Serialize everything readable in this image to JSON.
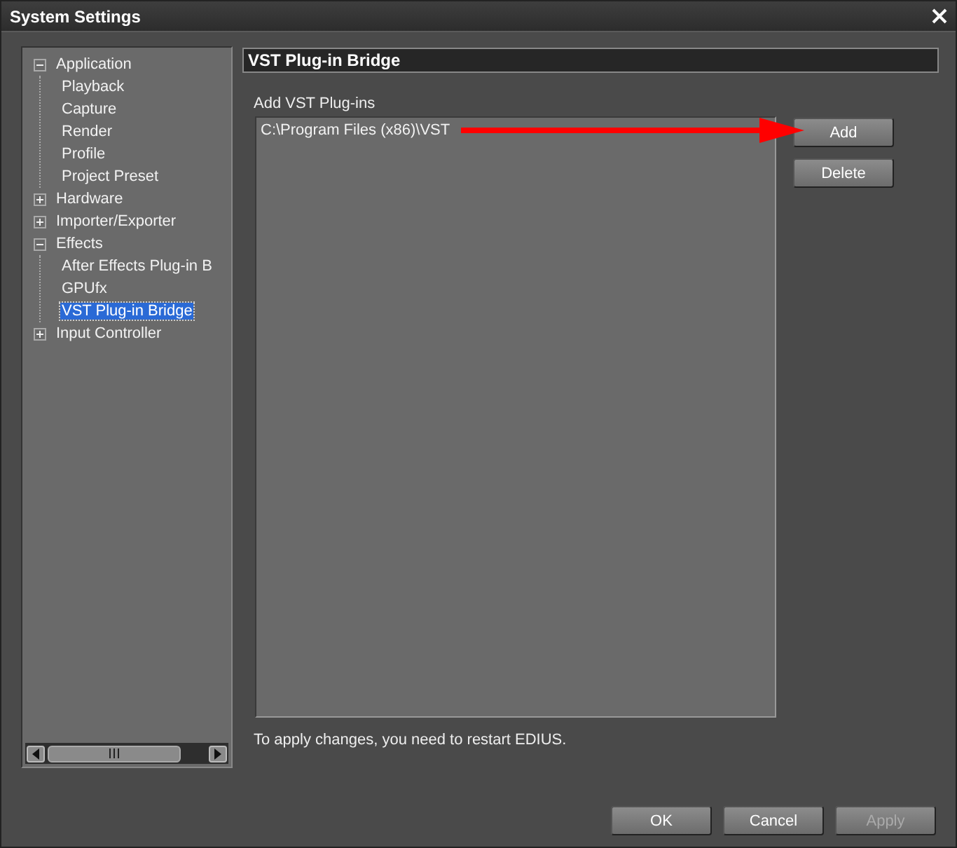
{
  "window": {
    "title": "System Settings"
  },
  "tree": [
    {
      "label": "Application",
      "expanded": true,
      "selected": false,
      "children": [
        {
          "label": "Playback",
          "selected": false
        },
        {
          "label": "Capture",
          "selected": false
        },
        {
          "label": "Render",
          "selected": false
        },
        {
          "label": "Profile",
          "selected": false
        },
        {
          "label": "Project Preset",
          "selected": false
        }
      ]
    },
    {
      "label": "Hardware",
      "expanded": false,
      "selected": false
    },
    {
      "label": "Importer/Exporter",
      "expanded": false,
      "selected": false
    },
    {
      "label": "Effects",
      "expanded": true,
      "selected": false,
      "children": [
        {
          "label": "After Effects Plug-in B",
          "selected": false
        },
        {
          "label": "GPUfx",
          "selected": false
        },
        {
          "label": "VST Plug-in Bridge",
          "selected": true
        }
      ]
    },
    {
      "label": "Input Controller",
      "expanded": false,
      "selected": false
    }
  ],
  "panel": {
    "title": "VST Plug-in Bridge",
    "list_label": "Add VST Plug-ins",
    "paths": [
      {
        "text": "C:\\Program Files (x86)\\VST"
      }
    ],
    "side_buttons": [
      {
        "label": "Add",
        "disabled": false
      },
      {
        "label": "Delete",
        "disabled": false
      }
    ],
    "note": "To apply changes, you need to restart EDIUS."
  },
  "buttons": [
    {
      "label": "OK",
      "disabled": false
    },
    {
      "label": "Cancel",
      "disabled": false
    },
    {
      "label": "Apply",
      "disabled": true
    }
  ]
}
